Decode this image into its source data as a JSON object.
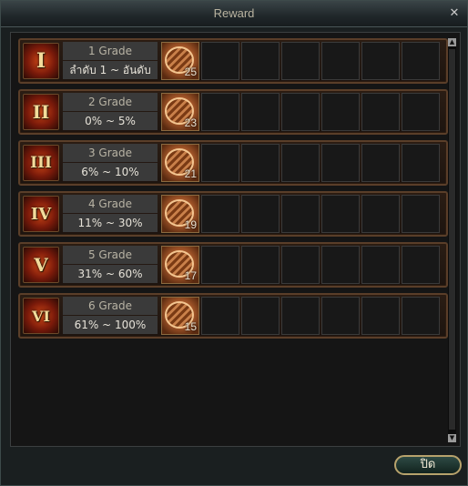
{
  "window": {
    "title": "Reward",
    "close_symbol": "✕"
  },
  "rows": [
    {
      "roman": "I",
      "grade": "1  Grade",
      "range": "ลำดับ  1  ~  อันดับ",
      "item_count": "25"
    },
    {
      "roman": "II",
      "grade": "2  Grade",
      "range": "0%  ~  5%",
      "item_count": "23"
    },
    {
      "roman": "III",
      "grade": "3  Grade",
      "range": "6%  ~  10%",
      "item_count": "21"
    },
    {
      "roman": "IV",
      "grade": "4  Grade",
      "range": "11%  ~  30%",
      "item_count": "19"
    },
    {
      "roman": "V",
      "grade": "5  Grade",
      "range": "31%  ~  60%",
      "item_count": "17"
    },
    {
      "roman": "VI",
      "grade": "6  Grade",
      "range": "61%  ~  100%",
      "item_count": "15"
    }
  ],
  "item_icon": "coin-icon",
  "close_button_label": "ปิด"
}
